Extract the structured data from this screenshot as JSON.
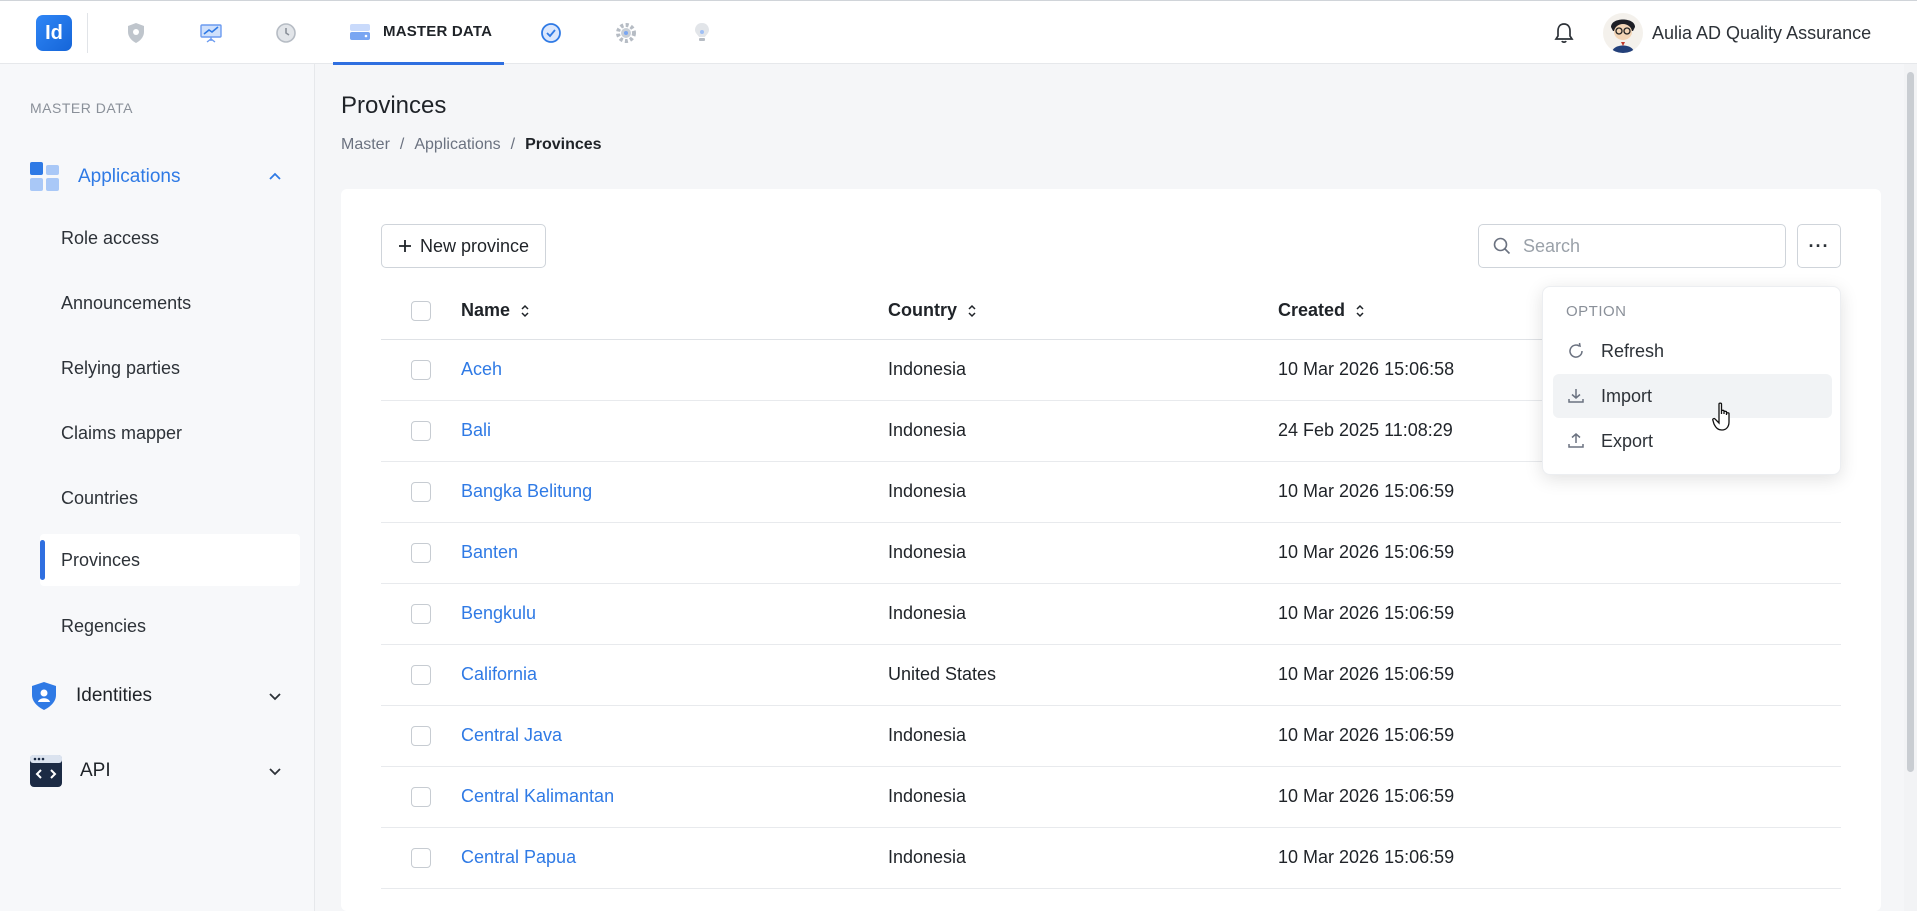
{
  "topbar": {
    "logo_text": "Id",
    "active_nav_label": "MASTER DATA",
    "user_name": "Aulia AD Quality Assurance",
    "nav_icons": [
      "shield-icon",
      "presentation-icon",
      "clock-icon",
      "drive-icon",
      "badge-check-icon",
      "gear-icon",
      "lightbulb-icon"
    ]
  },
  "sidebar": {
    "section_label": "MASTER DATA",
    "groups": [
      {
        "label": "Applications",
        "expanded": true,
        "color": "#2f7ae5"
      },
      {
        "label": "Identities",
        "expanded": false
      },
      {
        "label": "API",
        "expanded": false
      }
    ],
    "items": [
      {
        "label": "Role access"
      },
      {
        "label": "Announcements"
      },
      {
        "label": "Relying parties"
      },
      {
        "label": "Claims mapper"
      },
      {
        "label": "Countries"
      },
      {
        "label": "Provinces",
        "active": true
      },
      {
        "label": "Regencies"
      }
    ]
  },
  "page": {
    "title": "Provinces",
    "breadcrumb": [
      "Master",
      "Applications",
      "Provinces"
    ]
  },
  "toolbar": {
    "new_button_label": "New province",
    "search_placeholder": "Search",
    "more_label": "···"
  },
  "table": {
    "columns": [
      "Name",
      "Country",
      "Created"
    ],
    "rows": [
      {
        "name": "Aceh",
        "country": "Indonesia",
        "created": "10 Mar 2026 15:06:58"
      },
      {
        "name": "Bali",
        "country": "Indonesia",
        "created": "24 Feb 2025 11:08:29"
      },
      {
        "name": "Bangka Belitung",
        "country": "Indonesia",
        "created": "10 Mar 2026 15:06:59"
      },
      {
        "name": "Banten",
        "country": "Indonesia",
        "created": "10 Mar 2026 15:06:59"
      },
      {
        "name": "Bengkulu",
        "country": "Indonesia",
        "created": "10 Mar 2026 15:06:59"
      },
      {
        "name": "California",
        "country": "United States",
        "created": "10 Mar 2026 15:06:59"
      },
      {
        "name": "Central Java",
        "country": "Indonesia",
        "created": "10 Mar 2026 15:06:59"
      },
      {
        "name": "Central Kalimantan",
        "country": "Indonesia",
        "created": "10 Mar 2026 15:06:59"
      },
      {
        "name": "Central Papua",
        "country": "Indonesia",
        "created": "10 Mar 2026 15:06:59"
      }
    ]
  },
  "dropdown": {
    "header": "OPTION",
    "items": [
      {
        "label": "Refresh",
        "icon": "refresh-icon"
      },
      {
        "label": "Import",
        "icon": "download-icon",
        "hovered": true
      },
      {
        "label": "Export",
        "icon": "upload-icon"
      }
    ]
  },
  "colors": {
    "accent": "#2f6fe0",
    "link": "#2f7ae5"
  }
}
